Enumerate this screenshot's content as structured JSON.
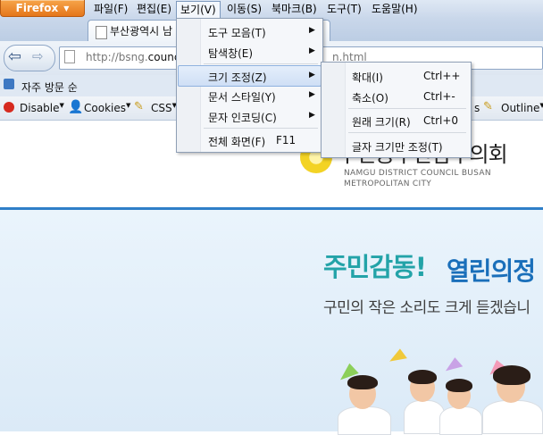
{
  "browser": {
    "app_button": "Firefox",
    "menubar": [
      "파일(F)",
      "편집(E)",
      "보기(V)",
      "이동(S)",
      "북마크(B)",
      "도구(T)",
      "도움말(H)"
    ]
  },
  "tab": {
    "title": "부산광역시 남"
  },
  "address": {
    "prefix": "http://bsng.",
    "domain_part": "counci",
    "tail": "n.html"
  },
  "bookmarks": {
    "item": "자주 방문 순"
  },
  "devbar": {
    "disable": "Disable",
    "cookies": "Cookies",
    "css": "CSS",
    "outline": "Outline",
    "partial": "s"
  },
  "view_menu": {
    "items": [
      {
        "label": "도구 모음(T)",
        "shortcut": "",
        "submenu": true
      },
      {
        "label": "탐색창(E)",
        "shortcut": "",
        "submenu": true
      },
      {
        "label": "크기 조정(Z)",
        "shortcut": "",
        "submenu": true
      },
      {
        "label": "문서 스타일(Y)",
        "shortcut": "",
        "submenu": true
      },
      {
        "label": "문자 인코딩(C)",
        "shortcut": "",
        "submenu": true
      },
      {
        "label": "전체 화면(F)",
        "shortcut": "F11",
        "submenu": false
      }
    ]
  },
  "zoom_menu": {
    "items": [
      {
        "label": "확대(I)",
        "shortcut": "Ctrl++"
      },
      {
        "label": "축소(O)",
        "shortcut": "Ctrl+-"
      },
      {
        "label": "원래 크기(R)",
        "shortcut": "Ctrl+0"
      },
      {
        "label": "글자 크기만 조정(T)",
        "shortcut": ""
      }
    ]
  },
  "site": {
    "name": "구민공부산남구의회",
    "sub_line1": "NAMGU DISTRICT COUNCIL BUSAN",
    "sub_line2": "METROPOLITAN CITY",
    "slogan_1": "주민감동!",
    "slogan_2": "열린의정",
    "sub_slogan": "구민의 작은 소리도 크게 듣겠습니"
  },
  "colors": {
    "accent": "#2f7fc8",
    "slogan_teal": "#23a3a8",
    "slogan_blue": "#1a6fba",
    "firefox_orange": "#e5761a"
  }
}
